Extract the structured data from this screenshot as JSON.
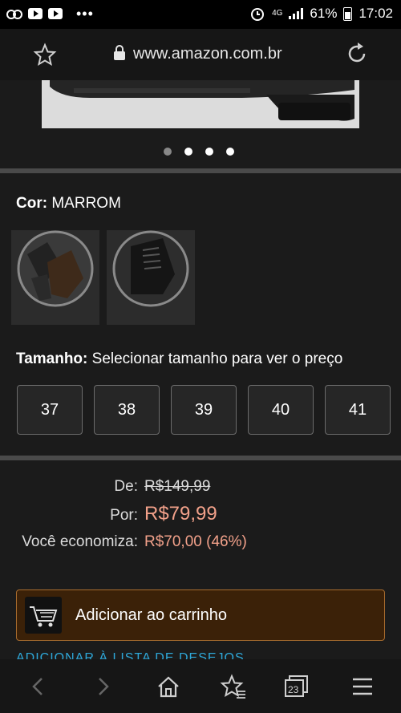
{
  "status_bar": {
    "battery": "61%",
    "time": "17:02",
    "network": "4G",
    "overflow": "•••"
  },
  "browser": {
    "url": "www.amazon.com.br",
    "tab_count": "23"
  },
  "carousel": {
    "total": 4,
    "active_index": 0
  },
  "product": {
    "color_label": "Cor:",
    "color_value": "MARROM",
    "size_label": "Tamanho:",
    "size_hint": "Selecionar tamanho para ver o preço",
    "sizes": [
      "37",
      "38",
      "39",
      "40",
      "41"
    ]
  },
  "pricing": {
    "de_label": "De:",
    "de_value": "R$149,99",
    "por_label": "Por:",
    "por_value": "R$79,99",
    "economiza_label": "Você economiza:",
    "economiza_value": "R$70,00 (46%)"
  },
  "actions": {
    "add_to_cart": "Adicionar ao carrinho",
    "wishlist": "ADICIONAR À LISTA DE DESEJOS"
  },
  "colors": {
    "accent_price": "#f2a18a",
    "cart_bg": "#3b2108",
    "link": "#2ea7d8"
  }
}
